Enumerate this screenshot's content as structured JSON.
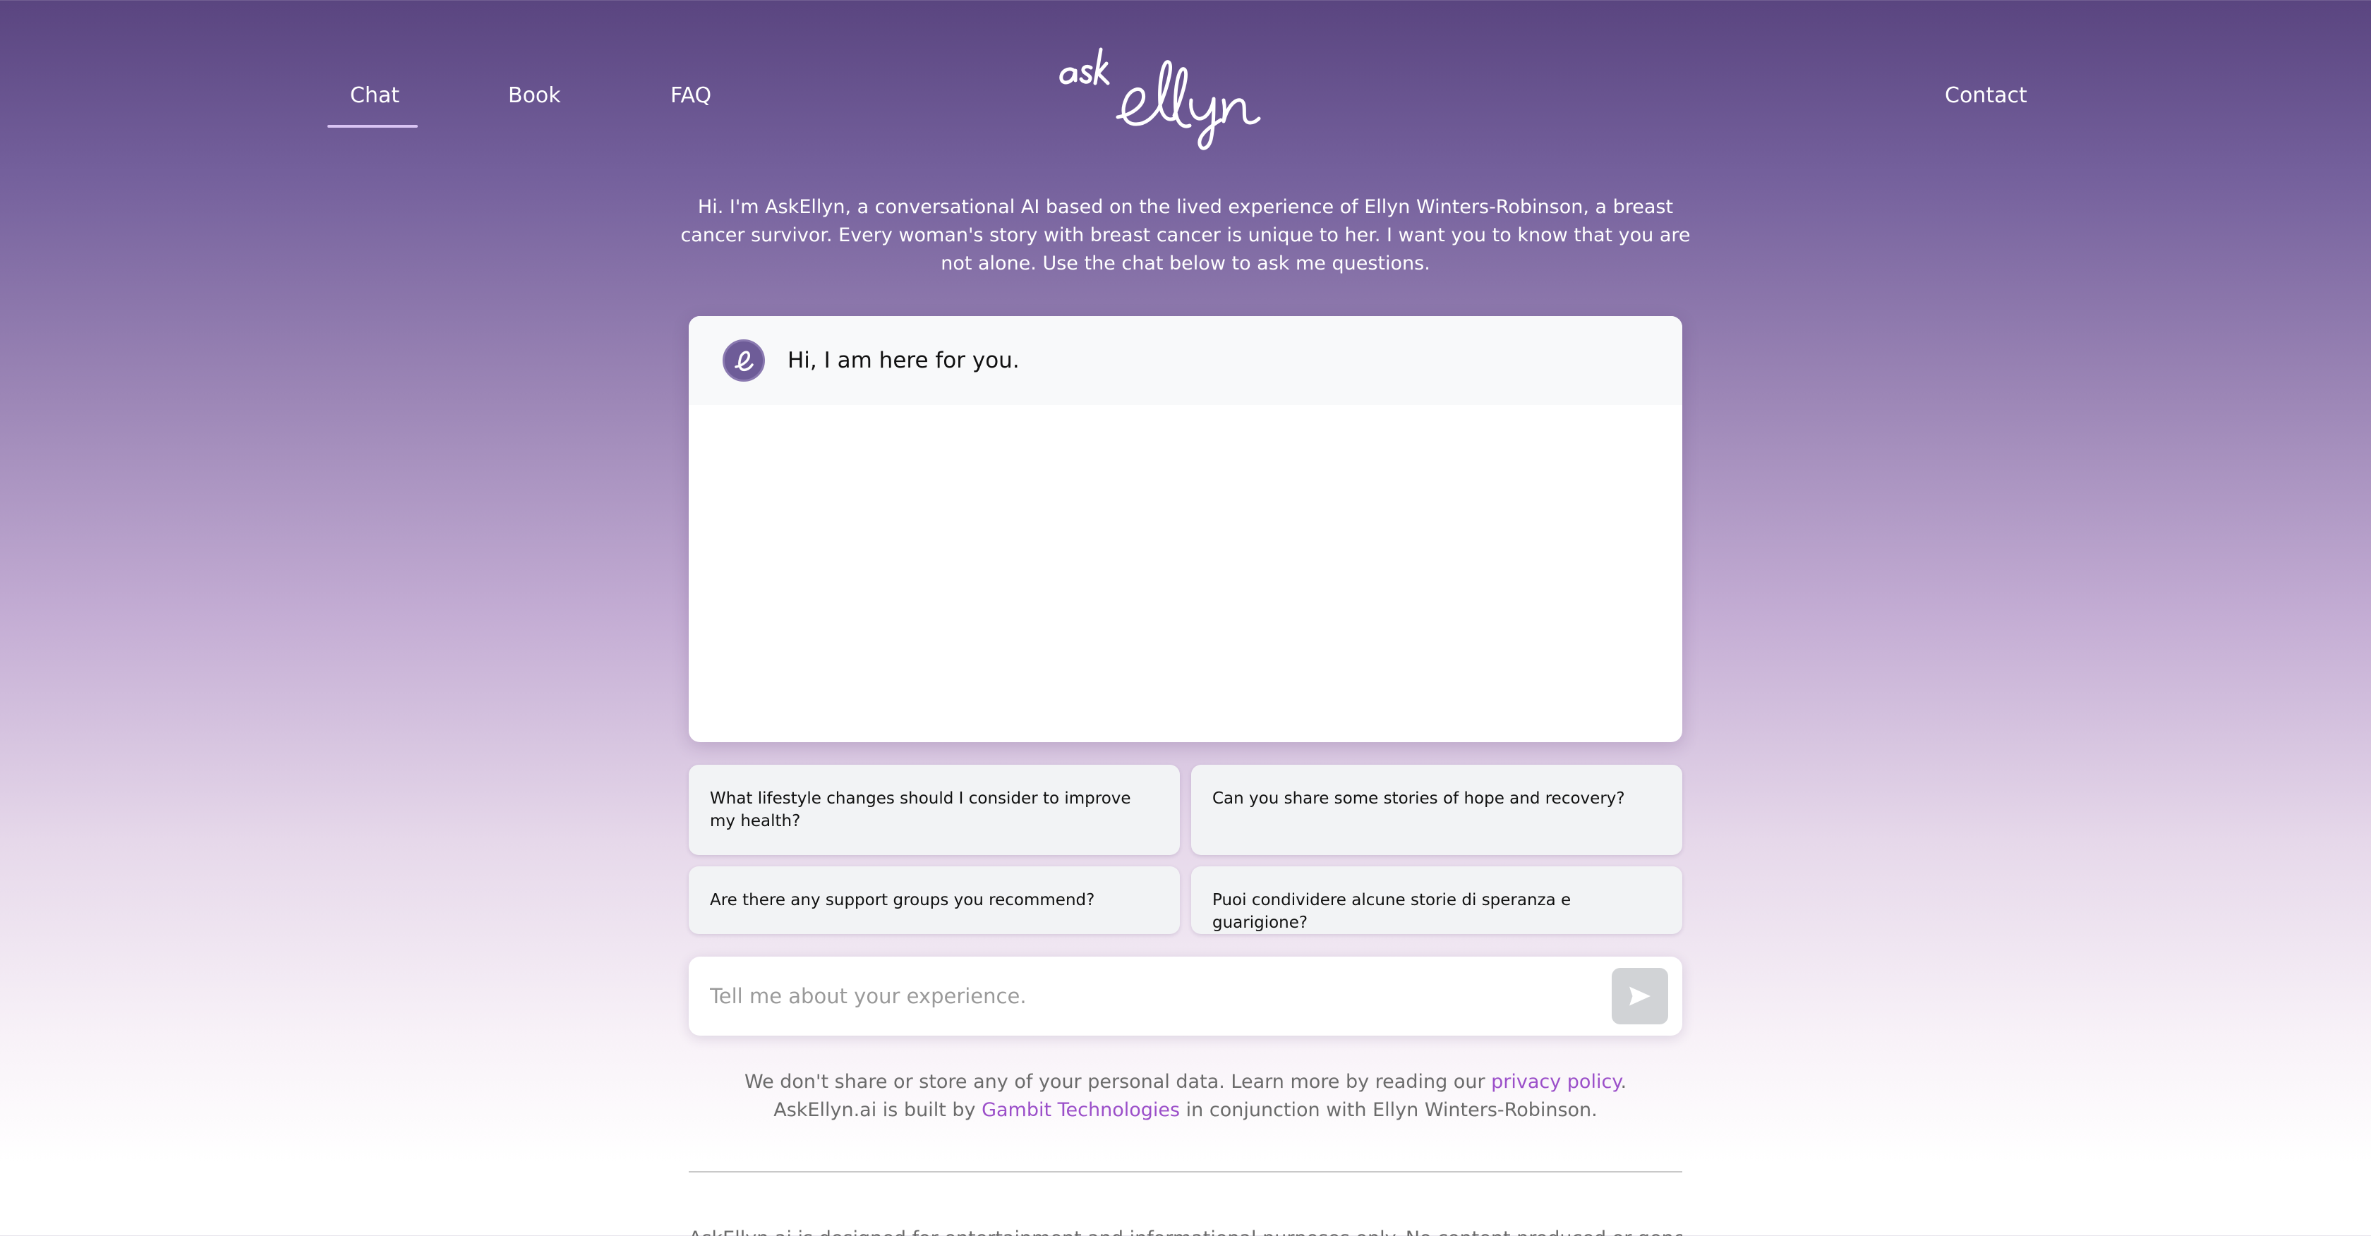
{
  "nav": {
    "chat": "Chat",
    "book": "Book",
    "faq": "FAQ",
    "contact": "Contact"
  },
  "logo": {
    "text": "askEllyn"
  },
  "intro": {
    "text": "Hi. I'm AskEllyn, a conversational AI based on the lived experience of Ellyn Winters-Robinson, a breast cancer survivor. Every woman's story with breast cancer is unique to her. I want you to know that you are not alone. Use the chat below to ask me questions."
  },
  "chat": {
    "greeting": "Hi, I am here for you.",
    "avatar_icon": "ellyn-e-avatar-icon"
  },
  "suggestions": [
    "What lifestyle changes should I consider to improve my health?",
    "Can you share some stories of hope and recovery?",
    "Are there any support groups you recommend?",
    "Puoi condividere alcune storie di speranza e guarigione?"
  ],
  "input": {
    "placeholder": "Tell me about your experience.",
    "send_icon": "send-icon"
  },
  "footer": {
    "privacy_prefix": "We don't share or store any of your personal data. Learn more by reading our ",
    "privacy_link": "privacy policy",
    "privacy_suffix": ".",
    "built_prefix": "AskEllyn.ai is built by ",
    "built_link": "Gambit Technologies",
    "built_suffix": " in conjunction with Ellyn Winters-Robinson.",
    "disclaimer": "AskEllyn.ai is designed for entertainment and informational purposes only. No content produced or generated as a"
  },
  "colors": {
    "accent_link": "#9b4fc9",
    "nav_underline": "#d9c4f4",
    "header_purple": "#5a4580"
  }
}
